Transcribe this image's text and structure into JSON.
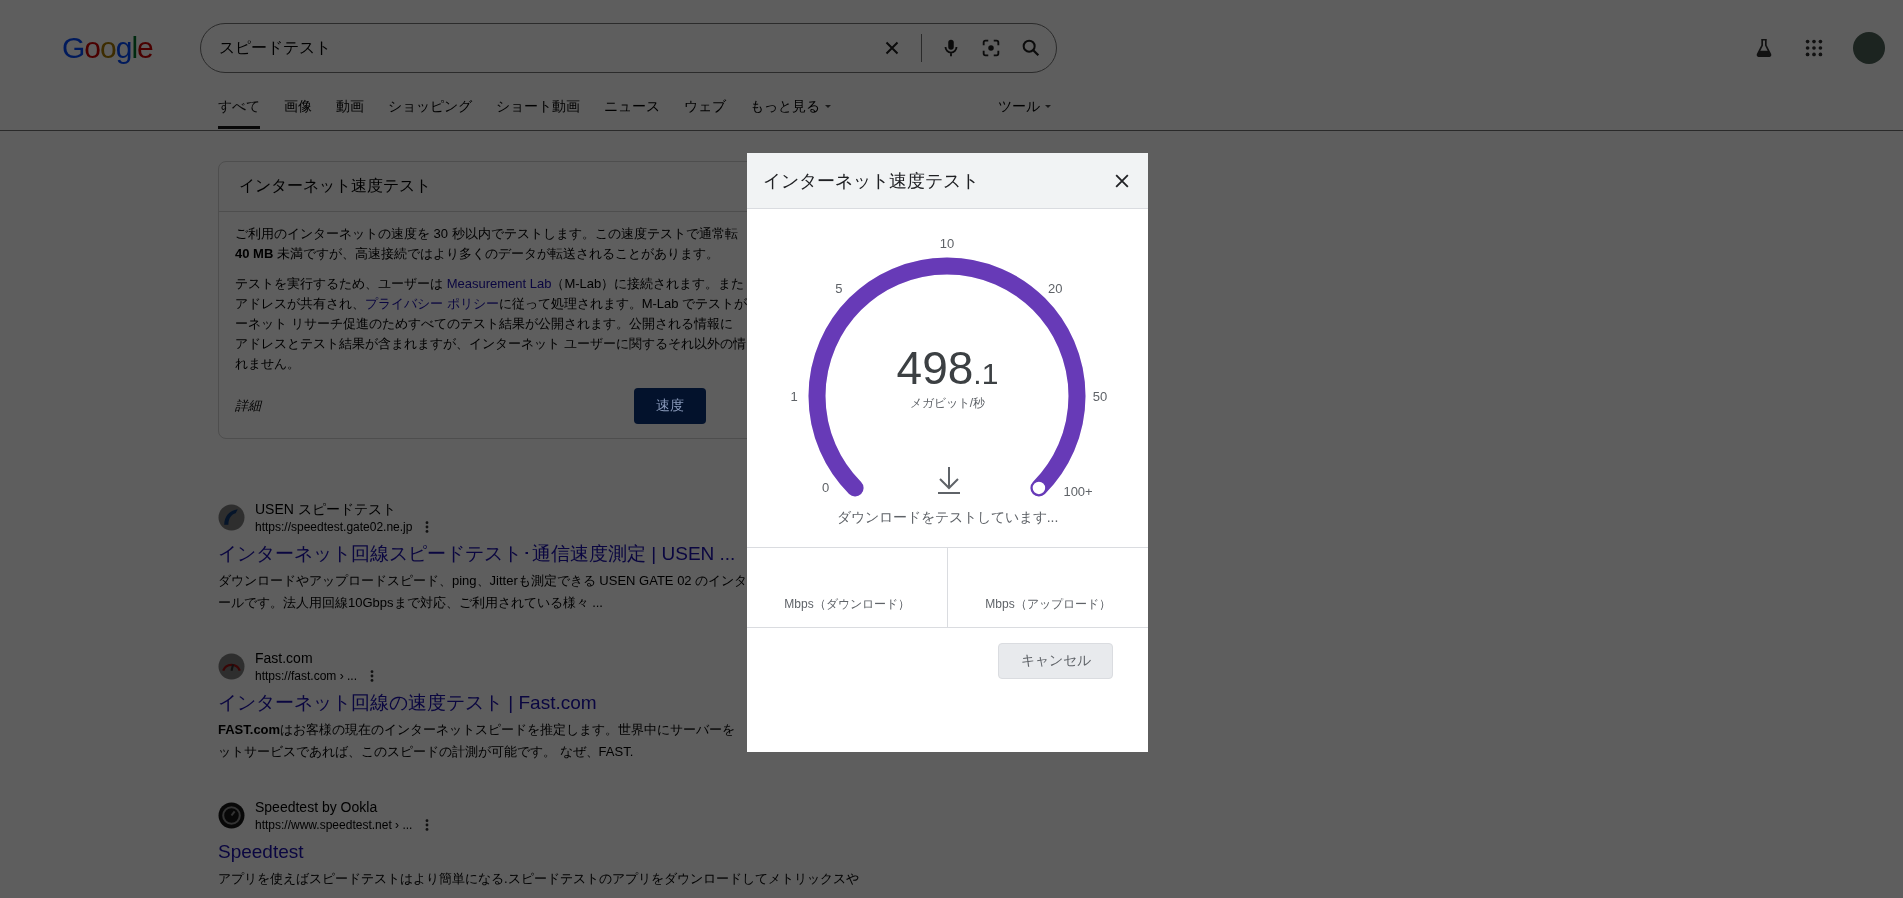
{
  "header": {
    "logo": "Google",
    "search": {
      "value": "スピードテスト"
    }
  },
  "tabs": [
    {
      "label": "すべて",
      "selected": true,
      "dropdown": false
    },
    {
      "label": "画像",
      "selected": false,
      "dropdown": false
    },
    {
      "label": "動画",
      "selected": false,
      "dropdown": false
    },
    {
      "label": "ショッピング",
      "selected": false,
      "dropdown": false
    },
    {
      "label": "ショート動画",
      "selected": false,
      "dropdown": false
    },
    {
      "label": "ニュース",
      "selected": false,
      "dropdown": false
    },
    {
      "label": "ウェブ",
      "selected": false,
      "dropdown": false
    },
    {
      "label": "もっと見る",
      "selected": false,
      "dropdown": true
    }
  ],
  "tools": {
    "label": "ツール"
  },
  "speed_card": {
    "title": "インターネット速度テスト",
    "paragraphs": [
      [
        [
          {
            "kind": "text",
            "text": "ご利用のインターネットの速度を 30 秒以内でテストします。この速度テストで通常転"
          }
        ],
        [
          {
            "kind": "bold",
            "text": "40 MB"
          },
          {
            "kind": "text",
            "text": " 未満ですが、高速接続ではより多くのデータが転送されることがあります。"
          }
        ]
      ],
      [
        [
          {
            "kind": "text",
            "text": "テストを実行するため、ユーザーは "
          },
          {
            "kind": "link",
            "text": "Measurement Lab"
          },
          {
            "kind": "text",
            "text": "（M-Lab）に接続されます。また"
          }
        ],
        [
          {
            "kind": "text",
            "text": "アドレスが共有され、"
          },
          {
            "kind": "link",
            "text": "プライバシー ポリシー"
          },
          {
            "kind": "text",
            "text": "に従って処理されます。M-Lab でテストが"
          }
        ],
        [
          {
            "kind": "text",
            "text": "ーネット リサーチ促進のためすべてのテスト結果が公開されます。公開される情報に"
          }
        ],
        [
          {
            "kind": "text",
            "text": "アドレスとテスト結果が含まれますが、インターネット ユーザーに関するそれ以外の情"
          }
        ],
        [
          {
            "kind": "text",
            "text": "れません。"
          }
        ]
      ]
    ],
    "details": "詳細",
    "run_button": "速度"
  },
  "results": [
    {
      "site": "USEN スピードテスト",
      "url": "https://speedtest.gate02.ne.jp",
      "title": "インターネット回線スピードテスト･通信速度測定 | USEN ...",
      "snippet": [
        [
          {
            "kind": "text",
            "text": "ダウンロードやアップロードスピード、ping、Jitterも測定できる USEN GATE 02 のインタ"
          }
        ],
        [
          {
            "kind": "text",
            "text": "ールです。法人用回線10Gbpsまで対応、ご利用されている様々 ..."
          }
        ]
      ]
    },
    {
      "site": "Fast.com",
      "url": "https://fast.com › ...",
      "title": "インターネット回線の速度テスト | Fast.com",
      "snippet": [
        [
          {
            "kind": "bold",
            "text": "FAST.com"
          },
          {
            "kind": "text",
            "text": "はお客様の現在のインターネットスピードを推定します。世界中にサーバーを"
          }
        ],
        [
          {
            "kind": "text",
            "text": "ットサービスであれば、このスピードの計測が可能です。 なぜ、FAST."
          }
        ]
      ]
    },
    {
      "site": "Speedtest by Ookla",
      "url": "https://www.speedtest.net › ...",
      "title": "Speedtest",
      "snippet": [
        [
          {
            "kind": "text",
            "text": "アプリを使えばスピードテストはより簡単になる.スピードテストのアプリをダウンロードしてメトリックスや"
          }
        ]
      ]
    }
  ],
  "dialog": {
    "title": "インターネット速度テスト",
    "gauge": {
      "ticks": [
        "0",
        "1",
        "5",
        "10",
        "20",
        "50",
        "100+"
      ],
      "level": 1,
      "reading_integer": "498",
      "reading_decimal": ".1",
      "unit": "メガビット/秒"
    },
    "status": "ダウンロードをテストしています...",
    "results": [
      {
        "label": "Mbps（ダウンロード）"
      },
      {
        "label": "Mbps（アップロード）"
      }
    ],
    "cancel_button": "キャンセル"
  }
}
